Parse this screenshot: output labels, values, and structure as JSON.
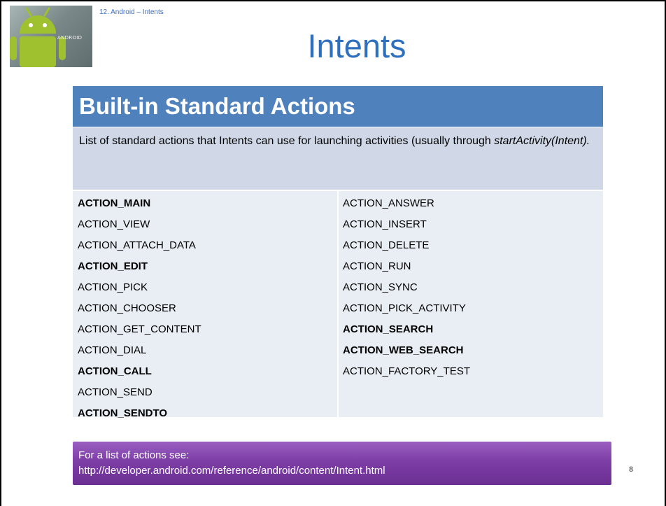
{
  "slide": {
    "breadcrumb": "12. Android – Intents",
    "title": "Intents",
    "logo_text": "ANDROID",
    "page_number": "8"
  },
  "header": {
    "heading": "Built-in Standard Actions"
  },
  "description": {
    "text": "List of standard actions that Intents can use for launching activities (usually through ",
    "code": "startActivity(Intent)."
  },
  "actions": {
    "left": [
      {
        "label": "ACTION_MAIN",
        "bold": true
      },
      {
        "label": "ACTION_VIEW",
        "bold": false
      },
      {
        "label": "ACTION_ATTACH_DATA",
        "bold": false
      },
      {
        "label": "ACTION_EDIT",
        "bold": true
      },
      {
        "label": "ACTION_PICK",
        "bold": false
      },
      {
        "label": "ACTION_CHOOSER",
        "bold": false
      },
      {
        "label": "ACTION_GET_CONTENT",
        "bold": false
      },
      {
        "label": "ACTION_DIAL",
        "bold": false
      },
      {
        "label": "ACTION_CALL",
        "bold": true
      },
      {
        "label": "ACTION_SEND",
        "bold": false
      },
      {
        "label": "ACTION_SENDTO",
        "bold": true
      }
    ],
    "right": [
      {
        "label": "ACTION_ANSWER",
        "bold": false
      },
      {
        "label": "ACTION_INSERT",
        "bold": false
      },
      {
        "label": "ACTION_DELETE",
        "bold": false
      },
      {
        "label": "ACTION_RUN",
        "bold": false
      },
      {
        "label": "ACTION_SYNC",
        "bold": false
      },
      {
        "label": "ACTION_PICK_ACTIVITY",
        "bold": false
      },
      {
        "label": "ACTION_SEARCH",
        "bold": true
      },
      {
        "label": "ACTION_WEB_SEARCH",
        "bold": true
      },
      {
        "label": "ACTION_FACTORY_TEST",
        "bold": false
      }
    ]
  },
  "footer": {
    "line1": "For a list of actions see:",
    "line2": "http://developer.android.com/reference/android/content/Intent.html"
  },
  "colors": {
    "title": "#2e70be",
    "header_bar": "#4f81bd",
    "desc_box": "#d0d8e8",
    "list_box": "#e9edf4",
    "footer_box": "#7d3ea6",
    "android_green": "#9fc130"
  },
  "icons": [
    "android-logo-icon"
  ]
}
